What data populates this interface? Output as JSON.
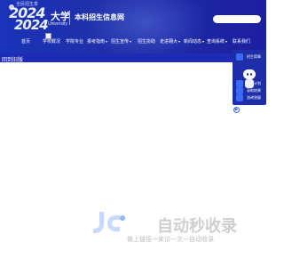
{
  "header": {
    "year_top": "2024",
    "year_bottom": "2024",
    "logo_caption": "全民招生季",
    "logo_subcaption": "招生季",
    "university_name_partial": "大学",
    "university_en": "University",
    "site_title": "本科招生信息网"
  },
  "nav": {
    "items": [
      {
        "label": "首页",
        "has_dropdown": false
      },
      {
        "label": "学校概况",
        "has_dropdown": false
      },
      {
        "label": "学院专业",
        "has_dropdown": false
      },
      {
        "label": "报考指南",
        "has_dropdown": true
      },
      {
        "label": "招生宣传",
        "has_dropdown": true
      },
      {
        "label": "招生协助",
        "has_dropdown": false
      },
      {
        "label": "走进翱大",
        "has_dropdown": true
      },
      {
        "label": "新闻动态",
        "has_dropdown": true
      },
      {
        "label": "查询系统",
        "has_dropdown": true
      },
      {
        "label": "联系我们",
        "has_dropdown": false
      }
    ]
  },
  "old_version_link": "回到旧版",
  "side_panel": {
    "items": [
      {
        "label": "招生简章",
        "icon": "document-icon"
      },
      {
        "label": "招生计划",
        "icon": "chart-icon"
      },
      {
        "label": "录取结果",
        "icon": "result-icon"
      },
      {
        "label": "咨询答疑",
        "icon": "chat-icon"
      }
    ],
    "collapse_symbol": "▶"
  },
  "watermark": {
    "text": "自动秒收录",
    "subtext": "做上链接一来访一次一自动收录"
  },
  "colors": {
    "primary": "#1f2fa8",
    "accent": "#3b6cf5",
    "text_on_dark": "#ffffff"
  }
}
